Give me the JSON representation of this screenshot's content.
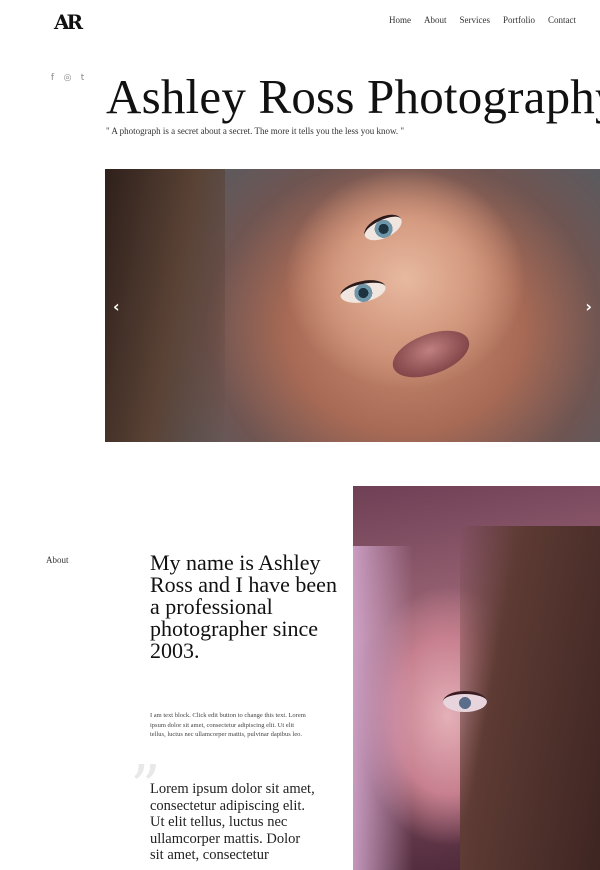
{
  "header": {
    "logo": "AR",
    "nav": [
      "Home",
      "About",
      "Services",
      "Portfolio",
      "Contact"
    ]
  },
  "social": {
    "icons": [
      {
        "name": "facebook-icon",
        "glyph": "f"
      },
      {
        "name": "instagram-icon",
        "glyph": "◎"
      },
      {
        "name": "tumblr-icon",
        "glyph": "t"
      }
    ]
  },
  "hero": {
    "title": "Ashley Ross Photography",
    "quote": "\" A photograph is a secret about a secret. The more it tells you the less you know. \""
  },
  "slider": {
    "prev_icon": "chevron-left-icon",
    "next_icon": "chevron-right-icon",
    "prev_glyph": "‹",
    "next_glyph": "›"
  },
  "about": {
    "label": "About",
    "heading": "My name is Ashley Ross and I have been a professional photographer since 2003.",
    "text": "I am text block. Click edit button to change this text. Lorem ipsum dolor sit amet, consectetur adipiscing elit. Ut elit tellus, luctus nec ullamcorper mattis, pulvinar dapibus leo.",
    "quote_mark": "”",
    "quote": "Lorem ipsum dolor sit amet, consectetur adipiscing elit. Ut elit tellus, luctus nec ullamcorper mattis. Dolor sit amet, consectetur"
  }
}
